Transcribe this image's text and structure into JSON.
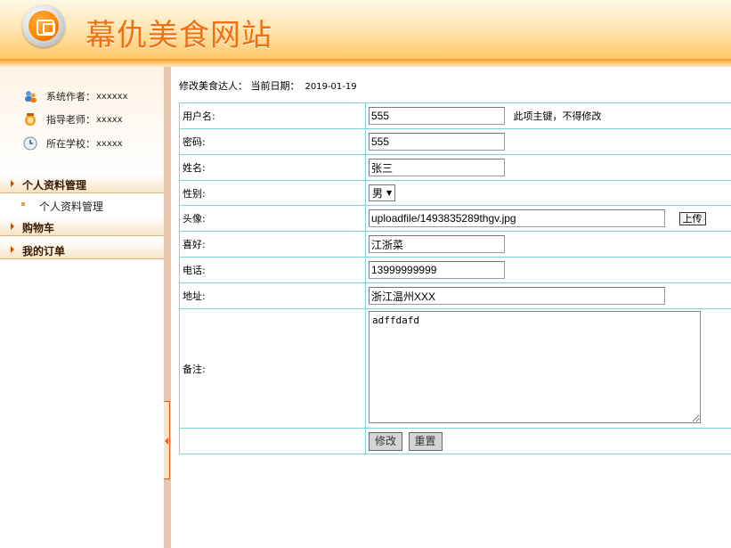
{
  "header": {
    "title": "幕仇美食网站"
  },
  "sidebar": {
    "info": [
      {
        "icon": "users-icon",
        "label": "系统作者：",
        "value": "xxxxxx"
      },
      {
        "icon": "teacher-icon",
        "label": "指导老师：",
        "value": "xxxxx"
      },
      {
        "icon": "clock-icon",
        "label": "所在学校：",
        "value": "xxxxx"
      }
    ],
    "menu": [
      {
        "label": "个人资料管理",
        "children": [
          "个人资料管理"
        ]
      },
      {
        "label": "购物车",
        "children": []
      },
      {
        "label": "我的订单",
        "children": []
      }
    ]
  },
  "breadcrumb": {
    "text": "修改美食达人：  当前日期：",
    "date": "2019-01-19"
  },
  "form": {
    "username": {
      "label": "用户名:",
      "value": "555",
      "hint": "此项主键，不得修改"
    },
    "password": {
      "label": "密码:",
      "value": "555"
    },
    "name": {
      "label": "姓名:",
      "value": "张三"
    },
    "gender": {
      "label": "性别:",
      "value": "男"
    },
    "avatar": {
      "label": "头像:",
      "value": "uploadfile/1493835289thgv.jpg",
      "upload_label": "上传"
    },
    "hobby": {
      "label": "喜好:",
      "value": "江浙菜"
    },
    "phone": {
      "label": "电话:",
      "value": "13999999999"
    },
    "address": {
      "label": "地址:",
      "value": "浙江温州XXX"
    },
    "remark": {
      "label": "备注:",
      "value": "adffdafd"
    },
    "submit_label": "修改",
    "reset_label": "重置"
  }
}
